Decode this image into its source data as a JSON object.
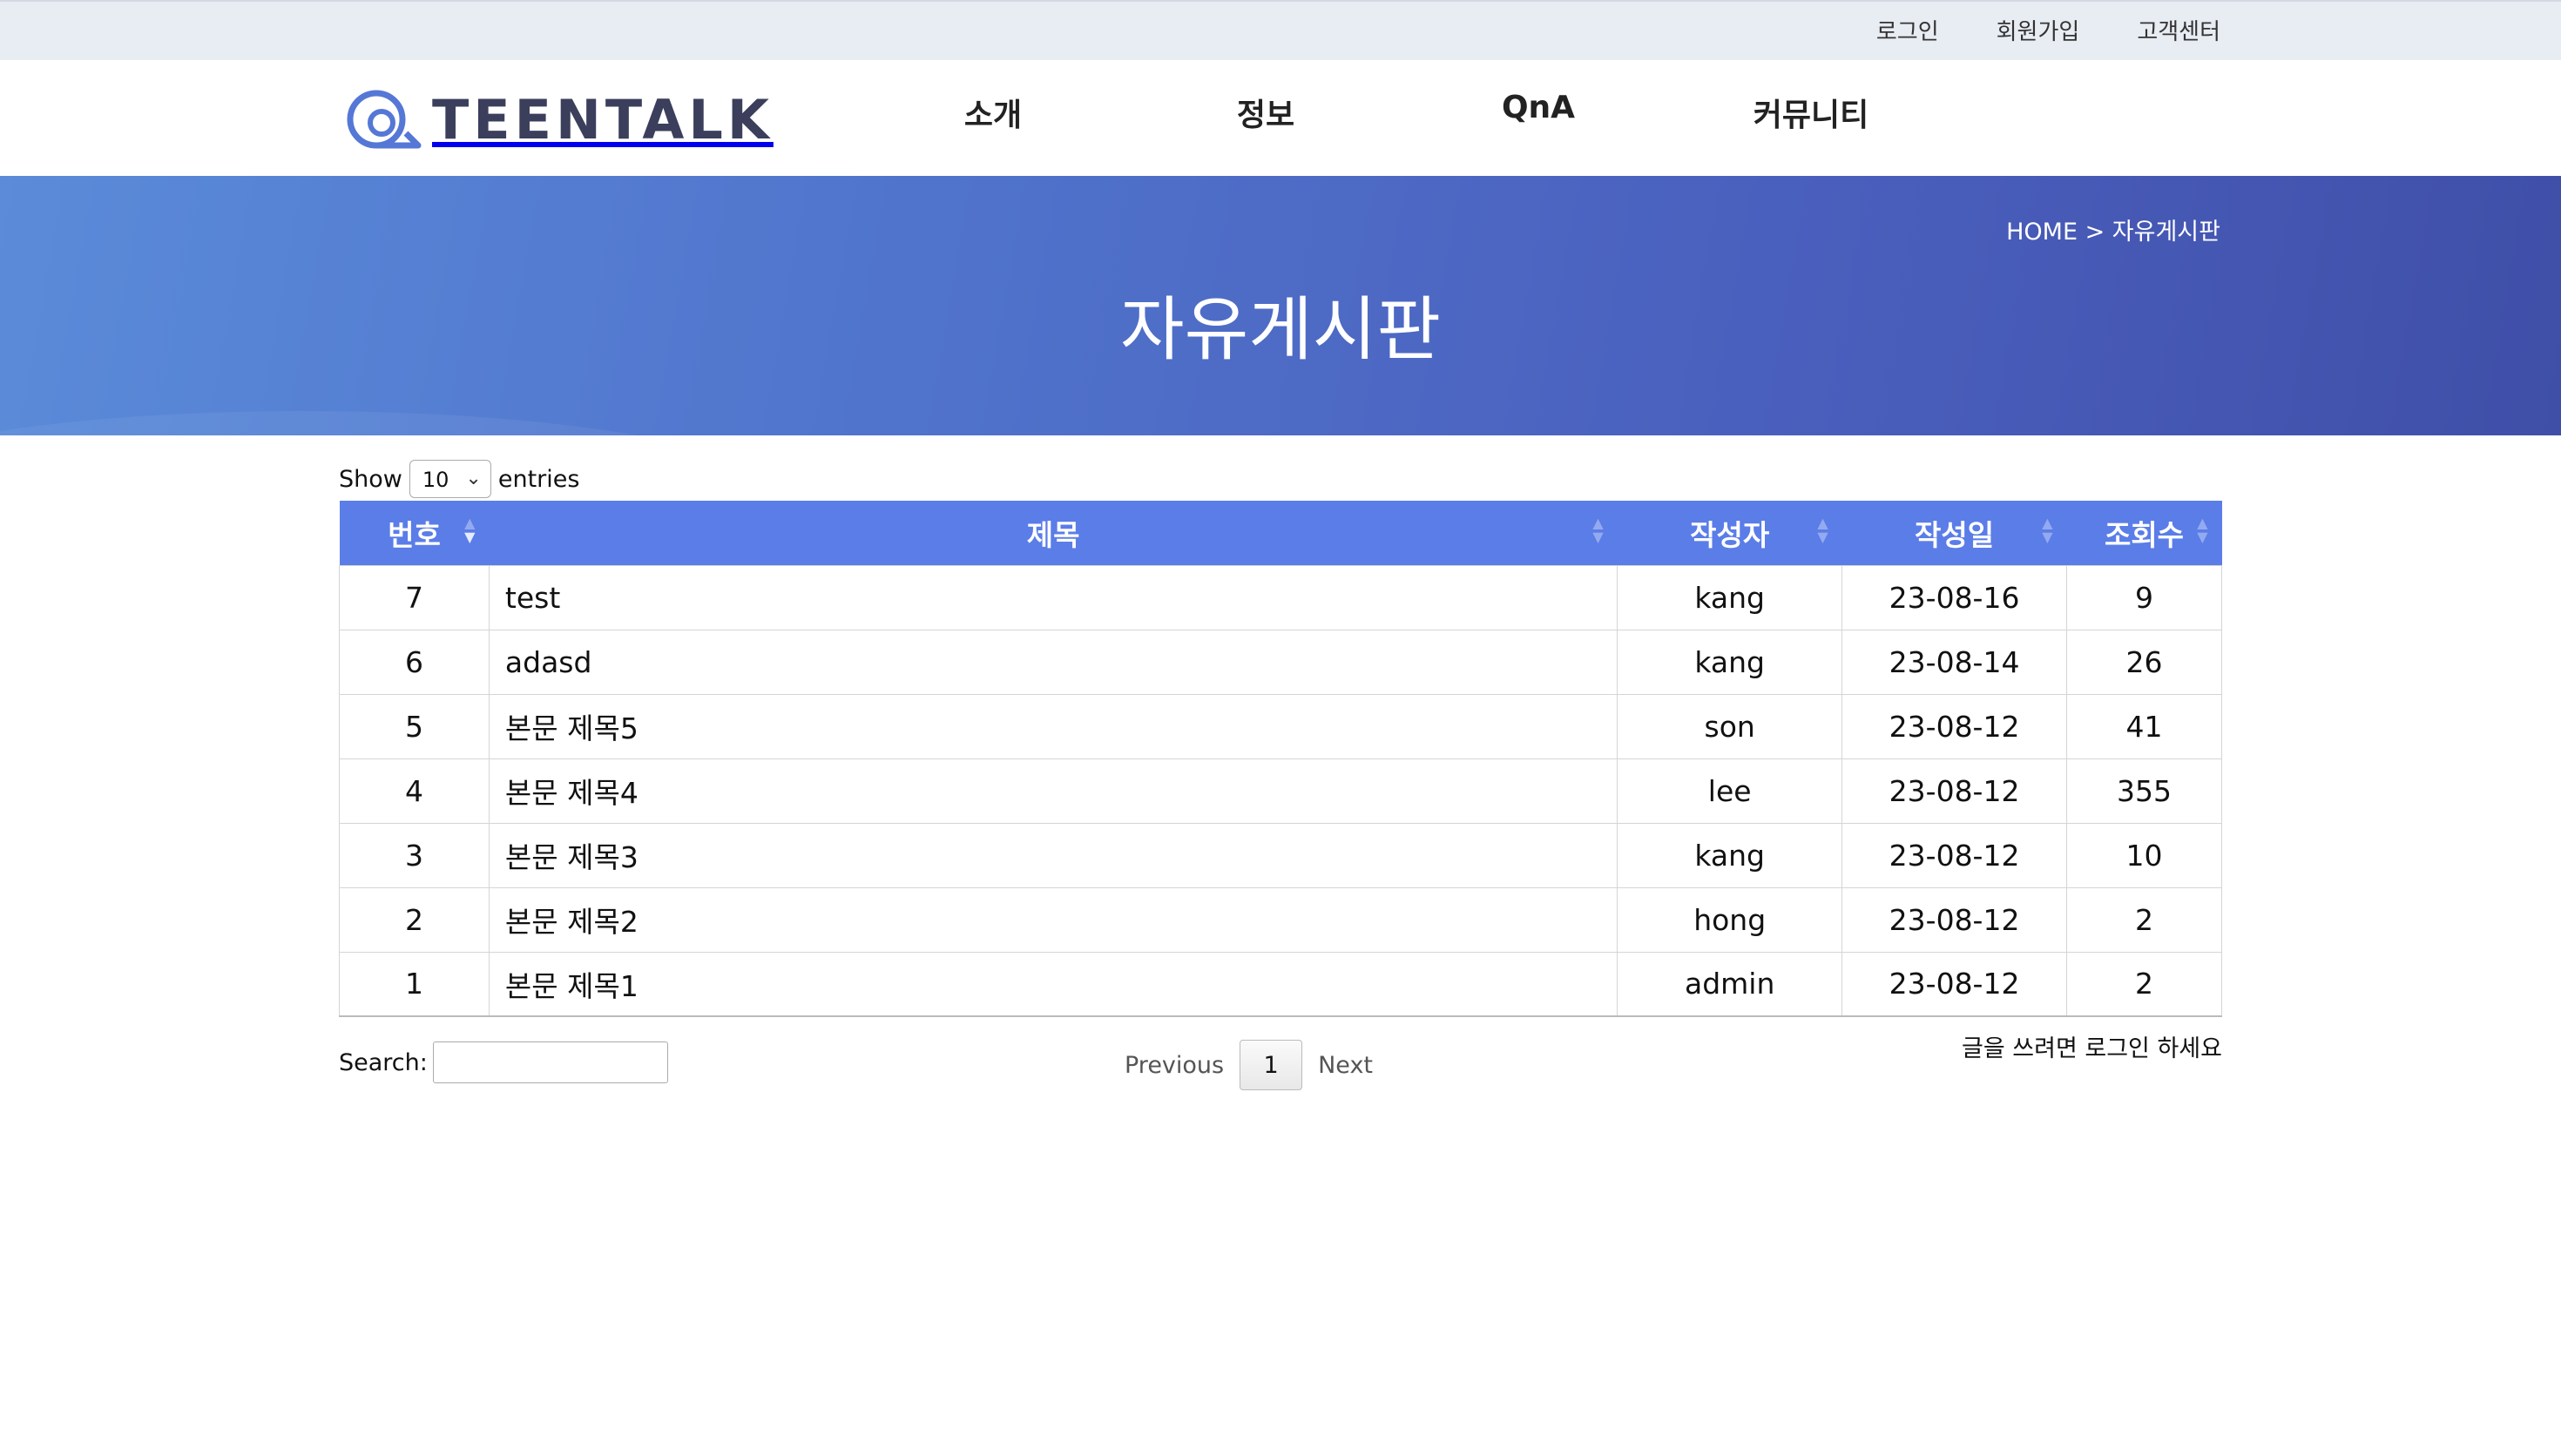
{
  "topbar": {
    "links": [
      "로그인",
      "회원가입",
      "고객센터"
    ]
  },
  "header": {
    "logo_text": "TEENTALK",
    "nav": [
      "소개",
      "정보",
      "QnA",
      "커뮤니티"
    ]
  },
  "banner": {
    "breadcrumb": "HOME > 자유게시판",
    "title": "자유게시판"
  },
  "length": {
    "show_label": "Show",
    "selected": "10",
    "entries_label": "entries"
  },
  "table": {
    "columns": [
      "번호",
      "제목",
      "작성자",
      "작성일",
      "조회수"
    ],
    "rows": [
      [
        "7",
        "test",
        "kang",
        "23-08-16",
        "9"
      ],
      [
        "6",
        "adasd",
        "kang",
        "23-08-14",
        "26"
      ],
      [
        "5",
        "본문 제목5",
        "son",
        "23-08-12",
        "41"
      ],
      [
        "4",
        "본문 제목4",
        "lee",
        "23-08-12",
        "355"
      ],
      [
        "3",
        "본문 제목3",
        "kang",
        "23-08-12",
        "10"
      ],
      [
        "2",
        "본문 제목2",
        "hong",
        "23-08-12",
        "2"
      ],
      [
        "1",
        "본문 제목1",
        "admin",
        "23-08-12",
        "2"
      ]
    ]
  },
  "search": {
    "label": "Search:",
    "value": ""
  },
  "pager": {
    "previous": "Previous",
    "current": "1",
    "next": "Next"
  },
  "notice": "글을 쓰려면 로그인 하세요",
  "colors": {
    "banner": "#4f6fc9",
    "table_header": "#5b7de8",
    "topbar": "#e8ecf3"
  }
}
